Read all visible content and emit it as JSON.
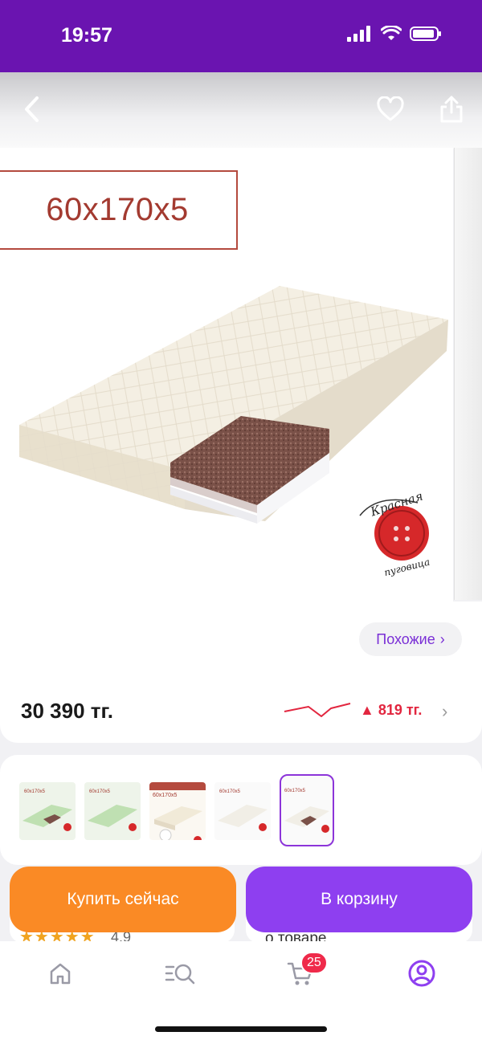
{
  "status_bar": {
    "time": "19:57"
  },
  "product": {
    "size_label": "60x170x5",
    "logo_text": "Красная пуговица",
    "similar_label": "Похожие",
    "price": "30 390 тг.",
    "price_change": "▲ 819 тг."
  },
  "gallery": {
    "thumbs": [
      {
        "label": "60x170x5",
        "color": "#bfe0b2"
      },
      {
        "label": "60x170x5",
        "color": "#bfe0b2"
      },
      {
        "label": "60x170x5",
        "color": "#f1ead8"
      },
      {
        "label": "60x170x5",
        "color": "#f1eee6"
      },
      {
        "label": "60x170x5",
        "color": "#f1eee6"
      }
    ],
    "selected_index": 4
  },
  "review": {
    "stars": "★★★★★",
    "rating": "4.9",
    "about_label": "о товаре"
  },
  "actions": {
    "buy_now": "Купить сейчас",
    "add_to_cart": "В корзину"
  },
  "tab_bar": {
    "cart_badge": "25"
  },
  "colors": {
    "brand": "#6a14b0",
    "buy": "#fa8a25",
    "cart": "#8e3ff0",
    "price_up": "#e2263f"
  }
}
